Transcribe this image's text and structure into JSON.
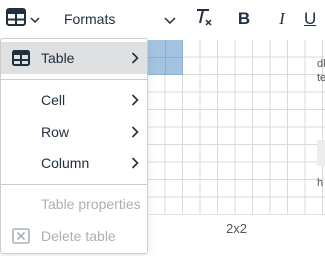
{
  "toolbar": {
    "table_icon": "table-icon",
    "formats_label": "Formats",
    "clear_format_icon": "clear-formatting-icon",
    "bold_label": "B",
    "italic_label": "I",
    "underline_label": "U"
  },
  "menu": {
    "items": [
      {
        "label": "Table",
        "icon": "table-icon",
        "state": "active",
        "has_submenu": true
      },
      {
        "label": "Cell",
        "has_submenu": true
      },
      {
        "label": "Row",
        "has_submenu": true
      },
      {
        "label": "Column",
        "has_submenu": true
      },
      {
        "label": "Table properties",
        "state": "disabled"
      },
      {
        "label": "Delete table",
        "icon": "delete-table-icon",
        "state": "disabled"
      }
    ]
  },
  "grid_picker": {
    "size_label": "2x2",
    "selected_rows": 2,
    "selected_cols": 2,
    "highlight_color": "#a4c3e0"
  },
  "document": {
    "fragment_1": "dl",
    "fragment_2": "te",
    "fragment_3": "h"
  },
  "colors": {
    "menu_active_bg": "#dee0e2",
    "text": "#222f3e",
    "disabled_text": "#aab0b6"
  }
}
